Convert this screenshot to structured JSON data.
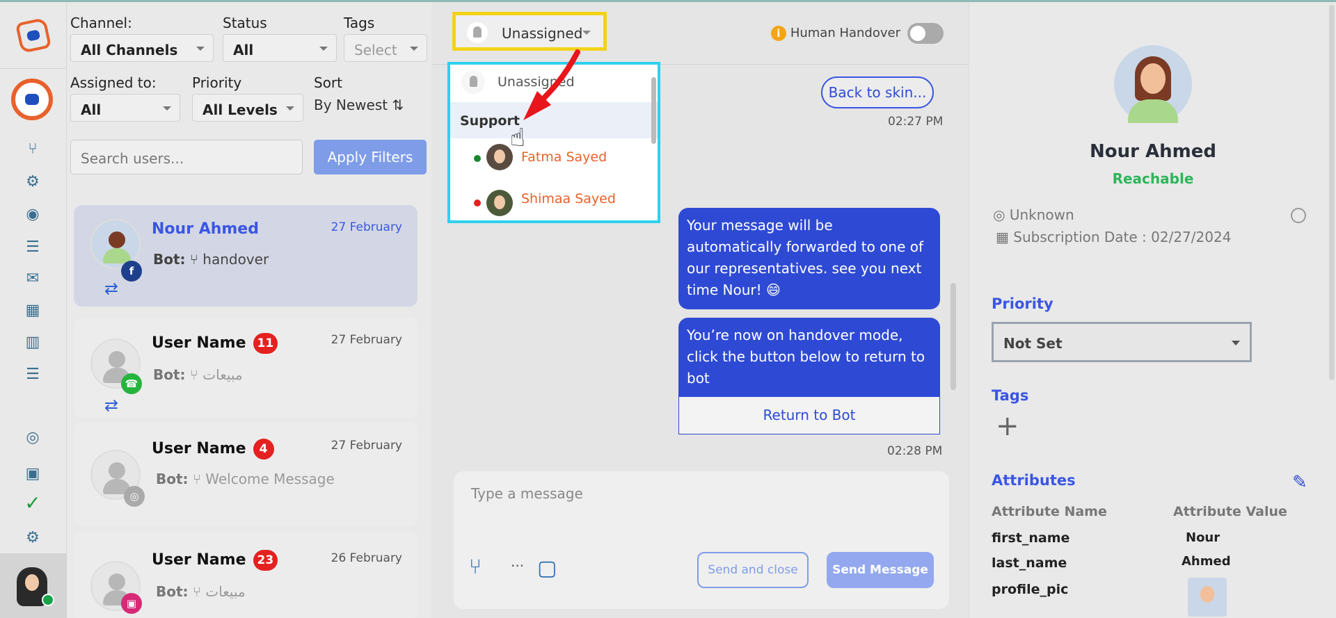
{
  "filters": {
    "channel_label": "Channel:",
    "channel_value": "All Channels",
    "status_label": "Status",
    "status_value": "All",
    "tags_label": "Tags",
    "tags_value": "Select",
    "assigned_label": "Assigned to:",
    "assigned_value": "All",
    "priority_label": "Priority",
    "priority_value": "All Levels",
    "sort_label": "Sort",
    "sort_value": "By Newest ⇅",
    "search_placeholder": "Search users...",
    "apply_label": "Apply Filters"
  },
  "conversations": [
    {
      "name": "Nour Ahmed",
      "date": "27 February",
      "bot_prefix": "Bot:",
      "last": "handover",
      "channel": "facebook"
    },
    {
      "name": "User Name",
      "badge": "11",
      "date": "27 February",
      "bot_prefix": "Bot:",
      "last": "مبيعات",
      "channel": "whatsapp"
    },
    {
      "name": "User Name",
      "badge": "4",
      "date": "27 February",
      "bot_prefix": "Bot:",
      "last": "Welcome Message",
      "channel": "web"
    },
    {
      "name": "User Name",
      "badge": "23",
      "date": "26 February",
      "bot_prefix": "Bot:",
      "last": "مبيعات",
      "channel": "instagram"
    }
  ],
  "chat": {
    "assign_value": "Unassigned",
    "handover_label": "Human Handover",
    "dropdown": {
      "unassigned": "Unassigned",
      "group": "Support",
      "agent1": "Fatma Sayed",
      "agent2": "Shimaa Sayed"
    },
    "back_button": "Back to skin...",
    "time1": "02:27 PM",
    "msg1": "Your message will be automatically forwarded to one of our representatives. see you next time Nour! 😄",
    "msg2": "You’re now on handover mode, click the button below to return to bot",
    "return_button": "Return to Bot",
    "time2": "02:28 PM",
    "compose_placeholder": "Type a message",
    "more": "...",
    "send_close": "Send and close",
    "send": "Send Message"
  },
  "profile": {
    "name": "Nour Ahmed",
    "status": "Reachable",
    "location": "Unknown",
    "subscription": "Subscription Date : 02/27/2024",
    "priority_heading": "Priority",
    "priority_value": "Not Set",
    "tags_heading": "Tags",
    "attributes_heading": "Attributes",
    "attr_name_header": "Attribute Name",
    "attr_value_header": "Attribute Value",
    "attributes": [
      {
        "key": "first_name",
        "value": "Nour"
      },
      {
        "key": "last_name",
        "value": "Ahmed"
      },
      {
        "key": "profile_pic",
        "value": ""
      }
    ]
  },
  "colors": {
    "accent": "#3a56e3",
    "highlight_yellow": "#f4d21b",
    "highlight_cyan": "#2fd0ef",
    "arrow_red": "#e8151a",
    "success": "#2eb55a"
  }
}
